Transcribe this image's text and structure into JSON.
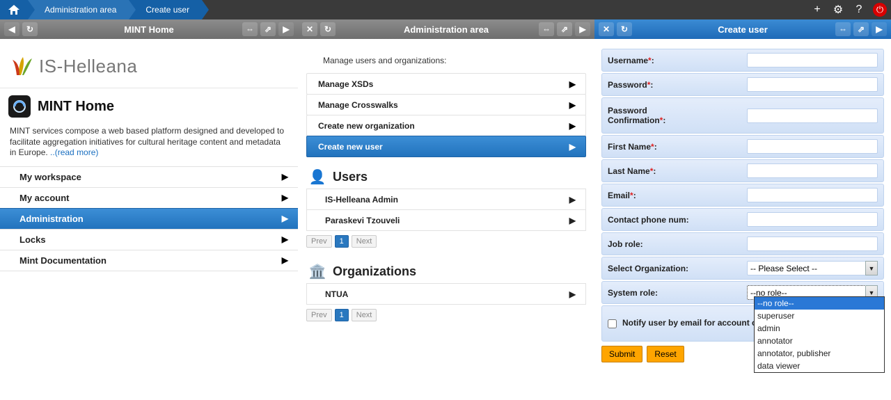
{
  "breadcrumb": {
    "admin": "Administration area",
    "create": "Create user"
  },
  "topIcons": {
    "plus": "+",
    "gear": "⚙",
    "help": "?",
    "power": "⏻"
  },
  "pane1": {
    "title": "MINT Home",
    "brand": "IS-Helleana",
    "homeTitle": "MINT Home",
    "homeDesc": "MINT services compose a web based platform designed and developed to facilitate aggregation initiatives for cultural heritage content and metadata in Europe. ",
    "readMore": "..(read more)",
    "menu": [
      {
        "label": "My workspace"
      },
      {
        "label": "My account"
      },
      {
        "label": "Administration"
      },
      {
        "label": "Locks"
      },
      {
        "label": "Mint Documentation"
      }
    ]
  },
  "pane2": {
    "title": "Administration area",
    "intro": "Manage users and organizations:",
    "items": [
      {
        "label": "Manage XSDs"
      },
      {
        "label": "Manage Crosswalks"
      },
      {
        "label": "Create new organization"
      },
      {
        "label": "Create new user"
      }
    ],
    "usersTitle": "Users",
    "users": [
      "IS-Helleana Admin",
      "Paraskevi Tzouveli"
    ],
    "orgsTitle": "Organizations",
    "orgs": [
      "NTUA"
    ],
    "pager": {
      "prev": "Prev",
      "page": "1",
      "next": "Next"
    }
  },
  "pane3": {
    "title": "Create user",
    "labels": {
      "username": "Username",
      "password": "Password",
      "passwordConf": "Password Confirmation",
      "firstName": "First Name",
      "lastName": "Last Name",
      "email": "Email",
      "phone": "Contact phone num:",
      "jobRole": "Job role:",
      "selectOrg": "Select Organization:",
      "systemRole": "System role:",
      "notify": "Notify user by email for account creation",
      "submit": "Submit",
      "reset": "Reset"
    },
    "orgPlaceholder": "-- Please Select --",
    "sysRoleValue": "--no role--",
    "sysRoleOptions": [
      "--no role--",
      "superuser",
      "admin",
      "annotator",
      "annotator, publisher",
      "data viewer"
    ]
  }
}
